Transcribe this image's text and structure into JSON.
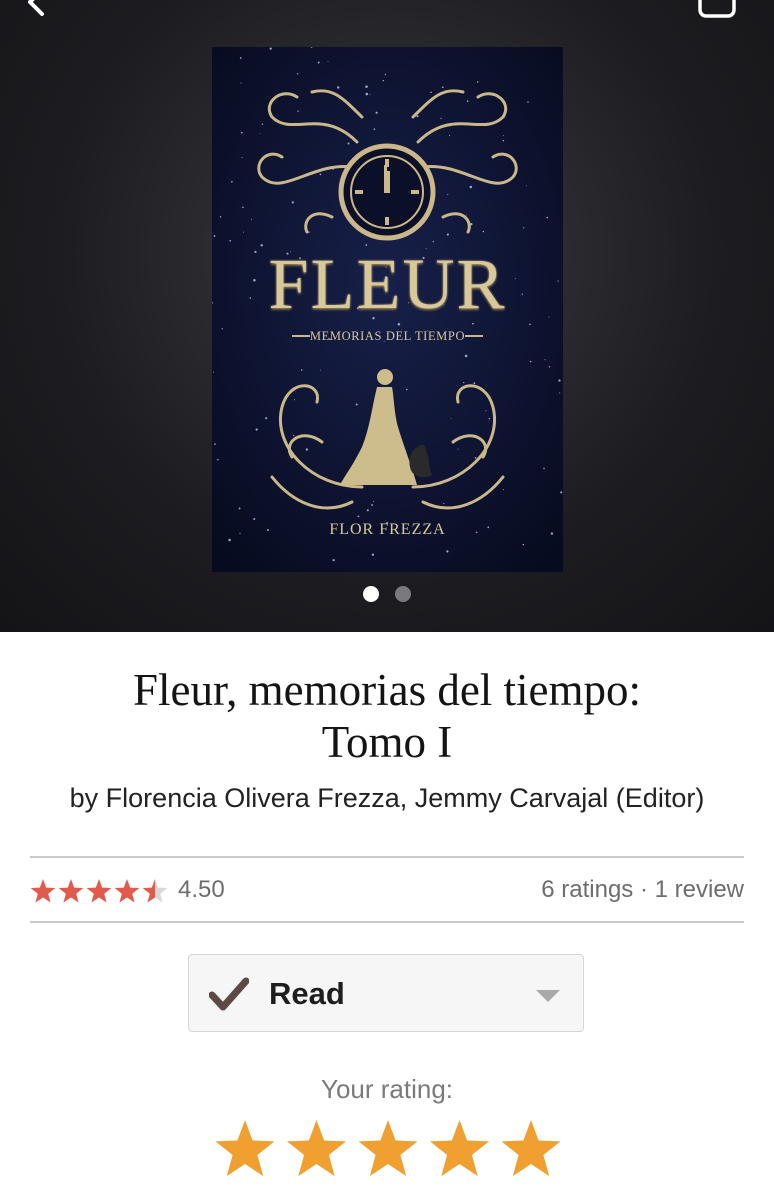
{
  "hero": {
    "cover": {
      "title": "FLEUR",
      "subtitle": "MEMORIAS DEL TIEMPO",
      "author": "FLOR FREZZA"
    },
    "carousel": {
      "total": 2,
      "active": 1
    }
  },
  "book": {
    "title_line1": "Fleur, memorias del tiempo:",
    "title_line2": "Tomo I",
    "authors": "by Florencia Olivera Frezza, Jemmy Carvajal (Editor)"
  },
  "stats": {
    "average": "4.50",
    "average_value": 4.5,
    "counts": "6 ratings · 1 review"
  },
  "shelf": {
    "label": "Read"
  },
  "your_rating": {
    "label": "Your rating:",
    "value": 5
  },
  "colors": {
    "star_small": "#e05b4b",
    "star_big": "#f0a030",
    "check": "#5d4a44",
    "hero_bg": "#1d1d21",
    "cover_bg": "#0c1230",
    "cover_gold": "#d9c89a"
  },
  "icons": {
    "back": "chevron-left-icon",
    "save": "bookmark-icon",
    "check": "checkmark-icon",
    "caret": "caret-down-icon",
    "star": "star-icon"
  }
}
